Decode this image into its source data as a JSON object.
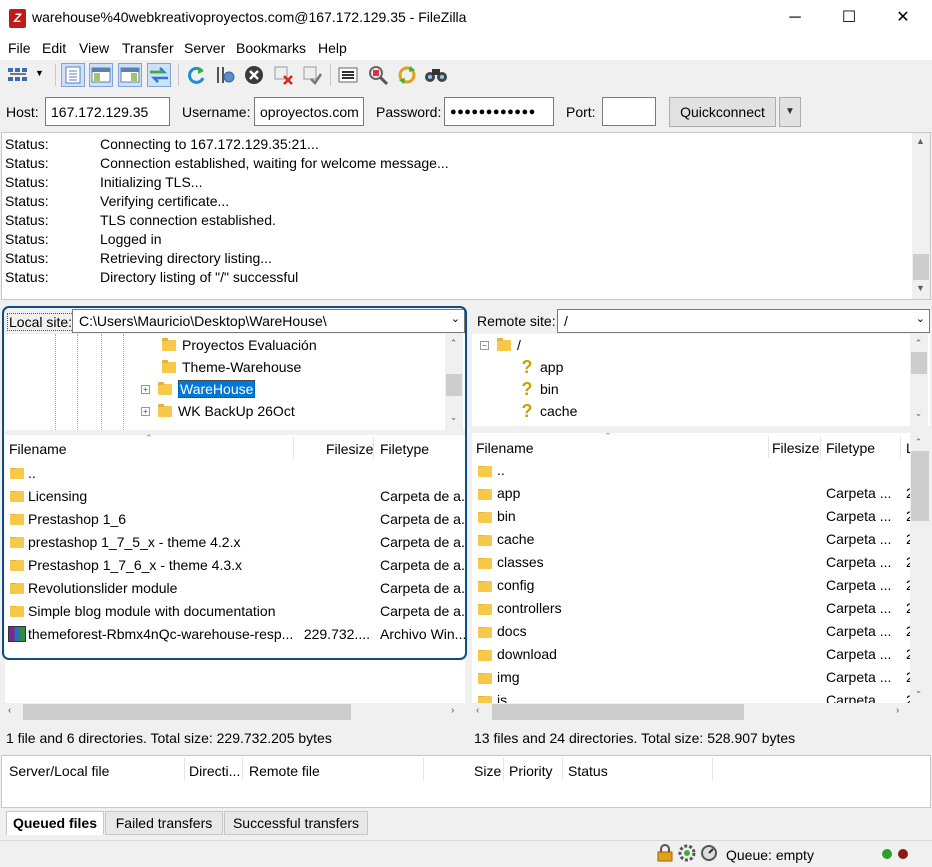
{
  "window": {
    "title": "warehouse%40webkreativoproyectos.com@167.172.129.35 - FileZilla",
    "app_icon": "Z",
    "controls": [
      "─",
      "☐",
      "✕"
    ]
  },
  "menu": [
    "File",
    "Edit",
    "View",
    "Transfer",
    "Server",
    "Bookmarks",
    "Help"
  ],
  "toolbar_icons": [
    "site-manager-icon",
    "toggle-log-icon",
    "toggle-local-tree-icon",
    "toggle-remote-tree-icon",
    "toggle-queue-icon",
    "refresh-icon",
    "process-queue-icon",
    "cancel-icon",
    "disconnect-icon",
    "reconnect-icon",
    "filter-icon",
    "compare-icon",
    "sync-browse-icon",
    "search-icon"
  ],
  "quickconnect": {
    "host_label": "Host:",
    "host_value": "167.172.129.35",
    "username_label": "Username:",
    "username_value": "oproyectos.com",
    "password_label": "Password:",
    "password_value": "●●●●●●●●●●●●",
    "port_label": "Port:",
    "port_value": "",
    "button_label": "Quickconnect"
  },
  "log": [
    {
      "label": "Status:",
      "message": "Connecting to 167.172.129.35:21..."
    },
    {
      "label": "Status:",
      "message": "Connection established, waiting for welcome message..."
    },
    {
      "label": "Status:",
      "message": "Initializing TLS..."
    },
    {
      "label": "Status:",
      "message": "Verifying certificate..."
    },
    {
      "label": "Status:",
      "message": "TLS connection established."
    },
    {
      "label": "Status:",
      "message": "Logged in"
    },
    {
      "label": "Status:",
      "message": "Retrieving directory listing..."
    },
    {
      "label": "Status:",
      "message": "Directory listing of \"/\" successful"
    }
  ],
  "local": {
    "site_label": "Local site:",
    "path": "C:\\Users\\Mauricio\\Desktop\\WareHouse\\",
    "tree": [
      {
        "name": "Proyectos Evaluación",
        "expander": false,
        "selected": false
      },
      {
        "name": "Theme-Warehouse",
        "expander": false,
        "selected": false
      },
      {
        "name": "WareHouse",
        "expander": true,
        "selected": true
      },
      {
        "name": "WK BackUp 26Oct",
        "expander": true,
        "selected": false
      }
    ],
    "columns": {
      "filename": "Filename",
      "filesize": "Filesize",
      "filetype": "Filetype"
    },
    "files": [
      {
        "name": "..",
        "size": "",
        "type": "",
        "icon": "folder"
      },
      {
        "name": "Licensing",
        "size": "",
        "type": "Carpeta de a...",
        "icon": "folder"
      },
      {
        "name": "Prestashop 1_6",
        "size": "",
        "type": "Carpeta de a...",
        "icon": "folder"
      },
      {
        "name": "prestashop 1_7_5_x - theme 4.2.x",
        "size": "",
        "type": "Carpeta de a...",
        "icon": "folder"
      },
      {
        "name": "Prestashop 1_7_6_x - theme 4.3.x",
        "size": "",
        "type": "Carpeta de a...",
        "icon": "folder"
      },
      {
        "name": "Revolutionslider module",
        "size": "",
        "type": "Carpeta de a...",
        "icon": "folder"
      },
      {
        "name": "Simple blog module with documentation",
        "size": "",
        "type": "Carpeta de a...",
        "icon": "folder"
      },
      {
        "name": "themeforest-Rbmx4nQc-warehouse-resp...",
        "size": "229.732....",
        "type": "Archivo Win...",
        "icon": "archive"
      }
    ],
    "status": "1 file and 6 directories. Total size: 229.732.205 bytes"
  },
  "remote": {
    "site_label": "Remote site:",
    "path": "/",
    "tree": [
      {
        "name": "/",
        "kind": "folder"
      },
      {
        "name": "app",
        "kind": "unknown"
      },
      {
        "name": "bin",
        "kind": "unknown"
      },
      {
        "name": "cache",
        "kind": "unknown"
      }
    ],
    "columns": {
      "filename": "Filename",
      "filesize": "Filesize",
      "filetype": "Filetype",
      "extra": "L"
    },
    "files": [
      {
        "name": "..",
        "type": ""
      },
      {
        "name": "app",
        "type": "Carpeta ..."
      },
      {
        "name": "bin",
        "type": "Carpeta ..."
      },
      {
        "name": "cache",
        "type": "Carpeta ..."
      },
      {
        "name": "classes",
        "type": "Carpeta ..."
      },
      {
        "name": "config",
        "type": "Carpeta ..."
      },
      {
        "name": "controllers",
        "type": "Carpeta ..."
      },
      {
        "name": "docs",
        "type": "Carpeta ..."
      },
      {
        "name": "download",
        "type": "Carpeta ..."
      },
      {
        "name": "img",
        "type": "Carpeta ..."
      },
      {
        "name": "js",
        "type": "Carpeta ..."
      }
    ],
    "extra_col_char": "2",
    "status": "13 files and 24 directories. Total size: 528.907 bytes"
  },
  "queue": {
    "columns": [
      "Server/Local file",
      "Directi...",
      "Remote file",
      "Size",
      "Priority",
      "Status"
    ],
    "tabs": [
      "Queued files",
      "Failed transfers",
      "Successful transfers"
    ],
    "status_text": "Queue: empty"
  },
  "colors": {
    "highlight": "#0a4f86",
    "selection": "#0078d7"
  }
}
